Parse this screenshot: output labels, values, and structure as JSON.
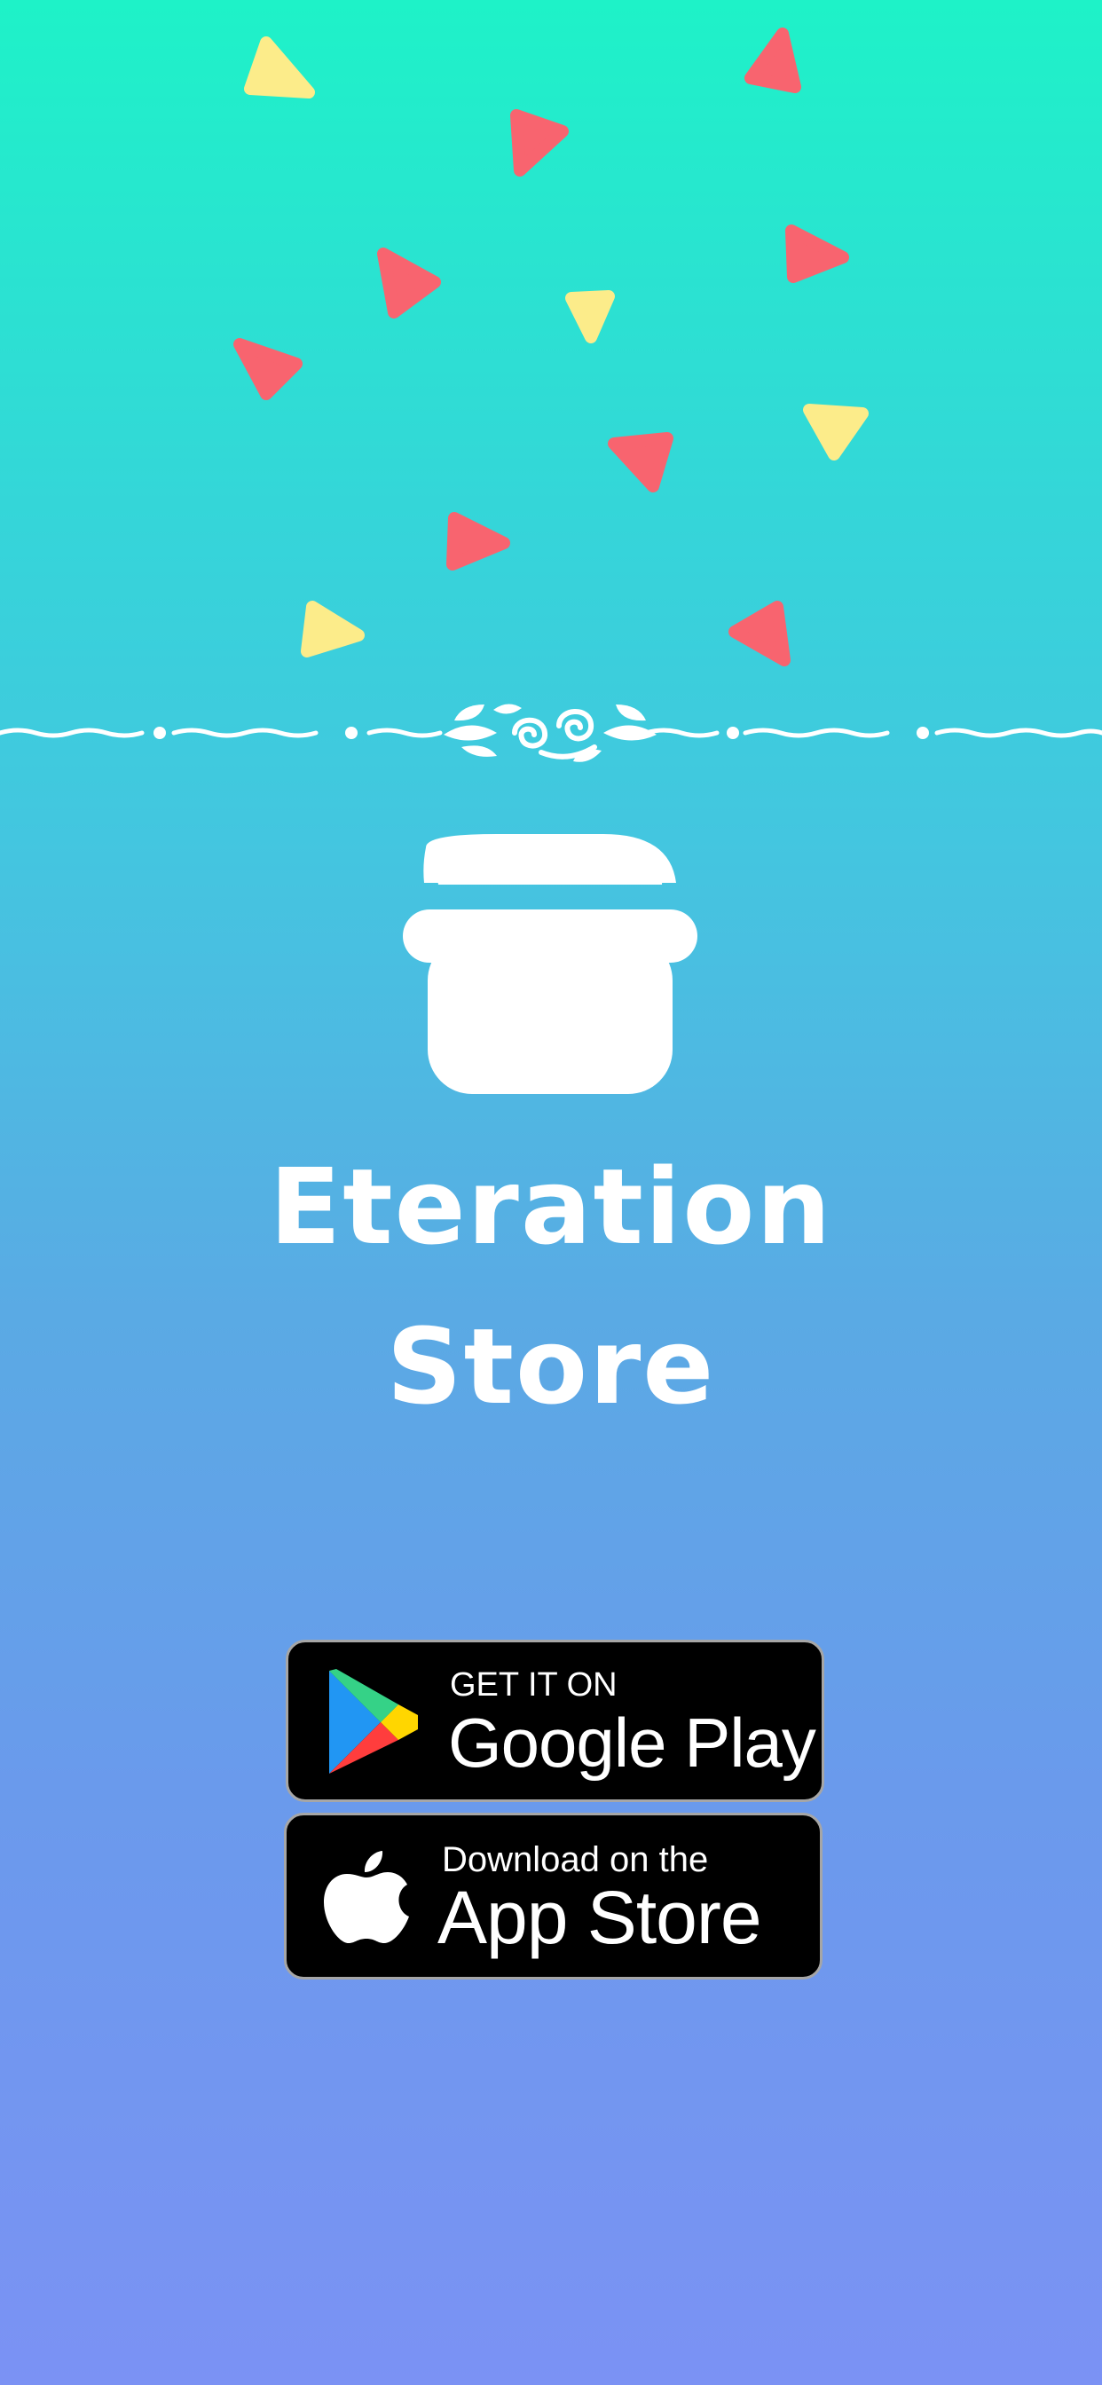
{
  "app": {
    "title_line1": "Eteration",
    "title_line2": "Store"
  },
  "badges": {
    "google": {
      "small_text": "GET IT ON",
      "big_text": "Google Play"
    },
    "apple": {
      "small_text": "Download on the",
      "big_text": "App Store"
    }
  },
  "icons": {
    "pot": "pot-icon",
    "google_play": "google-play-icon",
    "apple": "apple-icon",
    "ornament": "ornament-divider"
  },
  "colors": {
    "gradient_top": "#1ef2c8",
    "gradient_bottom": "#7b92f4",
    "confetti_red": "#f8646f",
    "confetti_yellow": "#fcec8a",
    "text": "#ffffff",
    "badge_bg": "#000000",
    "badge_border": "#a6a6a6"
  }
}
